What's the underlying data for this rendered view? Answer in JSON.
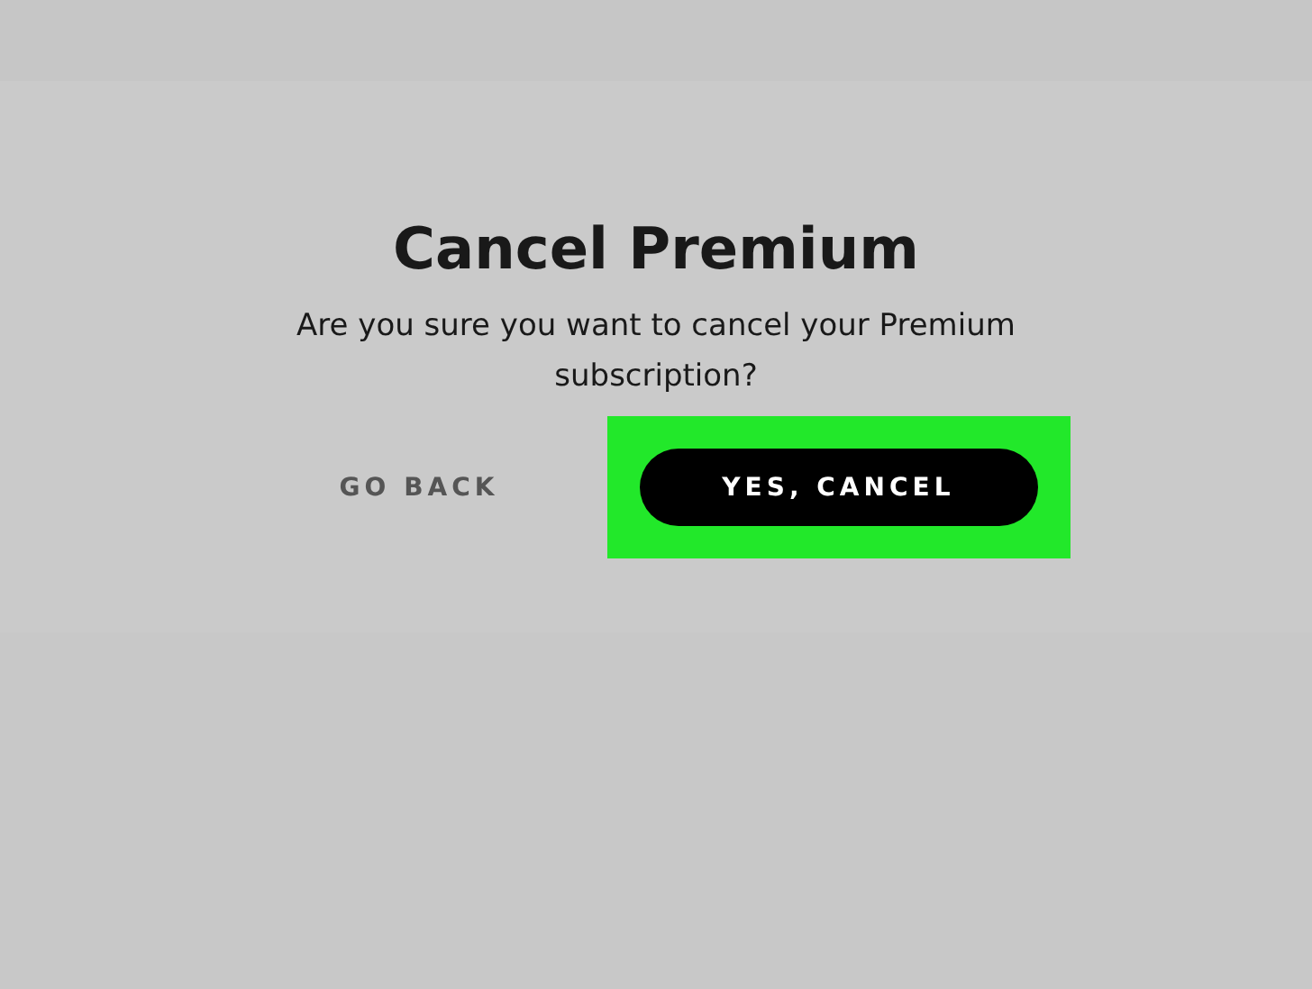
{
  "dialog": {
    "title": "Cancel Premium",
    "message": "Are you sure you want to cancel your Premium subscription?",
    "buttons": [
      {
        "label": "GO BACK",
        "kind": "text",
        "highlighted": false
      },
      {
        "label": "YES, CANCEL",
        "kind": "primary",
        "highlighted": true
      }
    ]
  }
}
